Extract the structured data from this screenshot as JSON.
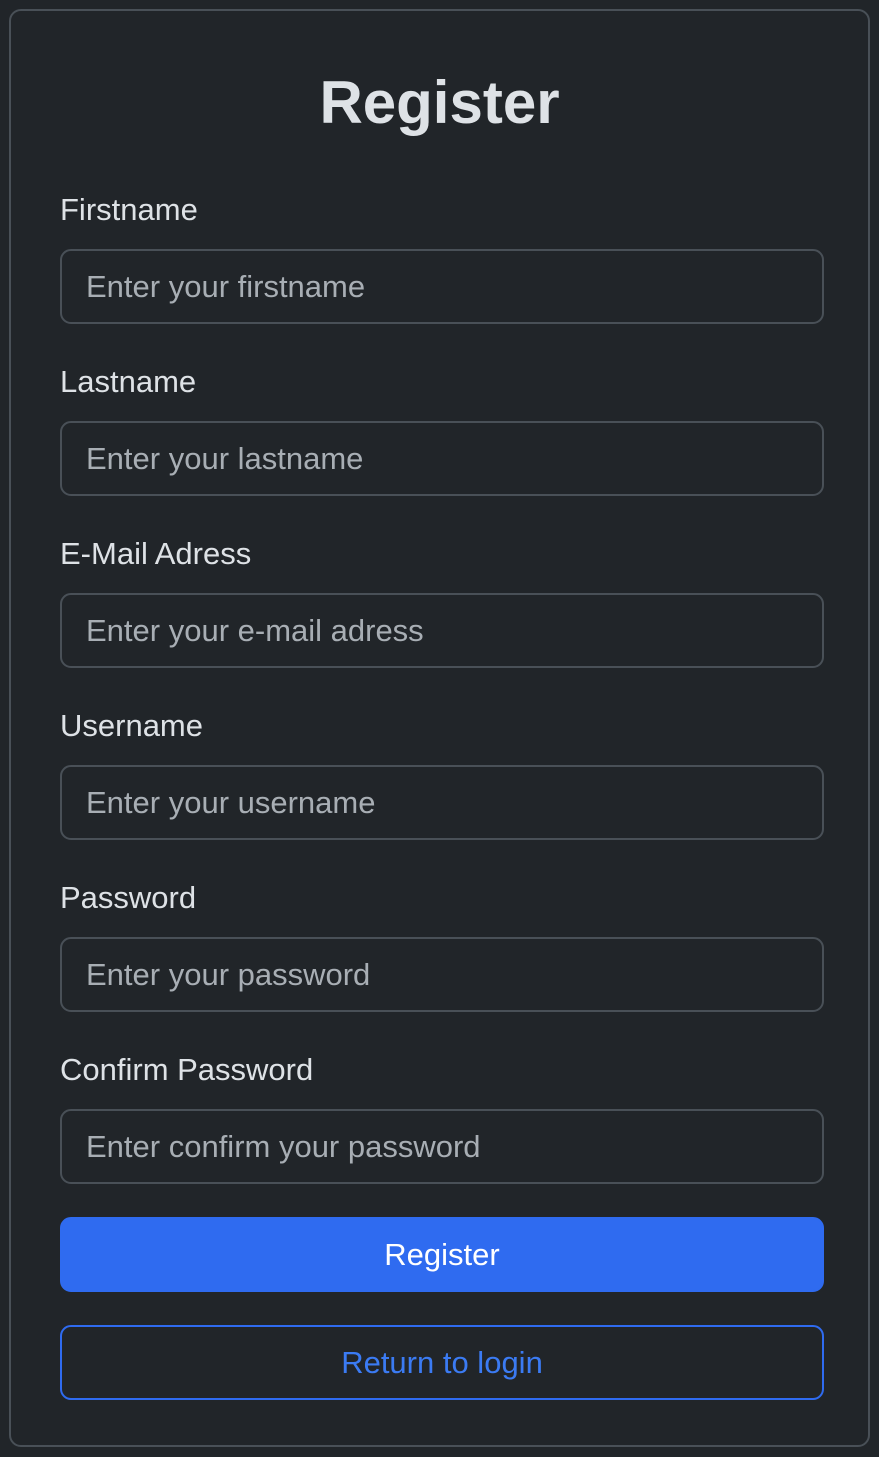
{
  "title": "Register",
  "fields": {
    "firstname": {
      "label": "Firstname",
      "placeholder": "Enter your firstname",
      "value": ""
    },
    "lastname": {
      "label": "Lastname",
      "placeholder": "Enter your lastname",
      "value": ""
    },
    "email": {
      "label": "E-Mail Adress",
      "placeholder": "Enter your e-mail adress",
      "value": ""
    },
    "username": {
      "label": "Username",
      "placeholder": "Enter your username",
      "value": ""
    },
    "password": {
      "label": "Password",
      "placeholder": "Enter your password",
      "value": ""
    },
    "confirm_password": {
      "label": "Confirm Password",
      "placeholder": "Enter confirm your password",
      "value": ""
    }
  },
  "buttons": {
    "register_label": "Register",
    "return_label": "Return to login"
  },
  "colors": {
    "background": "#212529",
    "border": "#495057",
    "text": "#dee2e6",
    "placeholder": "#a8aeb4",
    "primary": "#2f6bf0"
  }
}
